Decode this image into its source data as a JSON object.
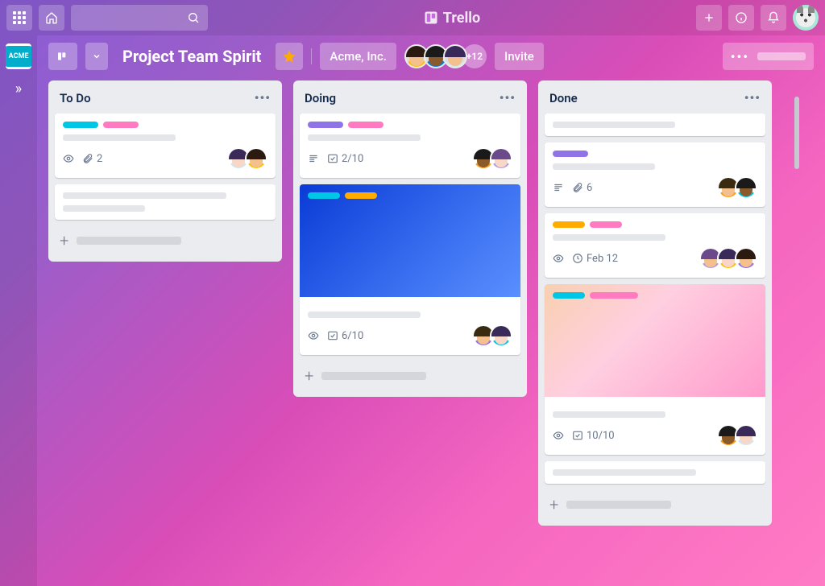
{
  "app": {
    "name": "Trello"
  },
  "topbar": {
    "search_placeholder": ""
  },
  "workspace": {
    "team_abbrev": "ACME"
  },
  "board": {
    "title": "Project Team Spirit",
    "starred": true,
    "org_name": "Acme, Inc.",
    "extra_members_label": "+12",
    "invite_label": "Invite"
  },
  "colors": {
    "cyan": "#00c7e5",
    "pink": "#ff7ac1",
    "purple": "#9173e8",
    "amber": "#ffab00",
    "blue_cover": "linear-gradient(135deg,#0a3bd6,#5a8fff)"
  },
  "lists": [
    {
      "title": "To Do",
      "cards": [
        {
          "labels": [
            "cyan",
            "pink"
          ],
          "badges": {
            "watch": true,
            "attachments": 2
          },
          "members": 2
        },
        {
          "labels": [],
          "placeholder_only": true
        }
      ]
    },
    {
      "title": "Doing",
      "cards": [
        {
          "labels": [
            "purple",
            "pink"
          ],
          "badges": {
            "description": true,
            "checklist": "2/10"
          },
          "members": 2
        },
        {
          "cover": "blue",
          "labels": [
            "cyan",
            "amber"
          ],
          "badges": {
            "watch": true,
            "checklist": "6/10"
          },
          "members": 2
        }
      ]
    },
    {
      "title": "Done",
      "cards": [
        {
          "placeholder_only": true
        },
        {
          "labels": [
            "purple"
          ],
          "badges": {
            "description": true,
            "attachments": 6
          },
          "members": 2
        },
        {
          "labels": [
            "amber",
            "pink"
          ],
          "badges": {
            "watch": true,
            "due": "Feb 12"
          },
          "members": 3
        },
        {
          "cover": "pink",
          "labels": [
            "cyan",
            "pink"
          ],
          "badges": {
            "watch": true,
            "checklist": "10/10"
          },
          "members": 2
        },
        {
          "placeholder_only": true
        }
      ]
    }
  ]
}
